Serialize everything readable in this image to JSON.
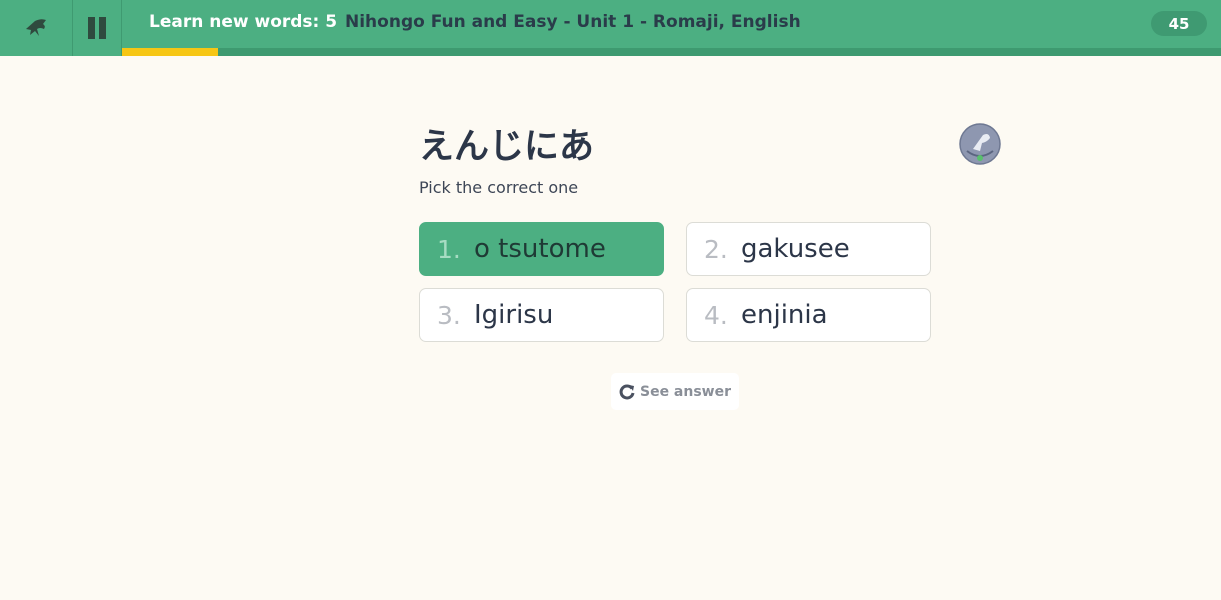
{
  "header": {
    "session_title": "Learn new words: 5",
    "course_title": "Nihongo Fun and Easy - Unit 1 - Romaji, English",
    "score": "45",
    "progress_fraction": 0.087
  },
  "question": {
    "prompt": "えんじにあ",
    "instruction": "Pick the correct one"
  },
  "choices": [
    {
      "number": "1.",
      "text": "o tsutome",
      "selected": true
    },
    {
      "number": "2.",
      "text": "gakusee",
      "selected": false
    },
    {
      "number": "3.",
      "text": "Igirisu",
      "selected": false
    },
    {
      "number": "4.",
      "text": "enjinia",
      "selected": false
    }
  ],
  "footer": {
    "see_answer_label": "See answer"
  },
  "icons": {
    "logo": "memrise-logo-icon",
    "pause": "pause-icon",
    "help": "help-icon",
    "reveal": "reveal-icon"
  },
  "colors": {
    "header_bg": "#4caf82",
    "progress": "#f6c614",
    "page_bg": "#fdfaf3",
    "selected_choice": "#4caf82"
  }
}
